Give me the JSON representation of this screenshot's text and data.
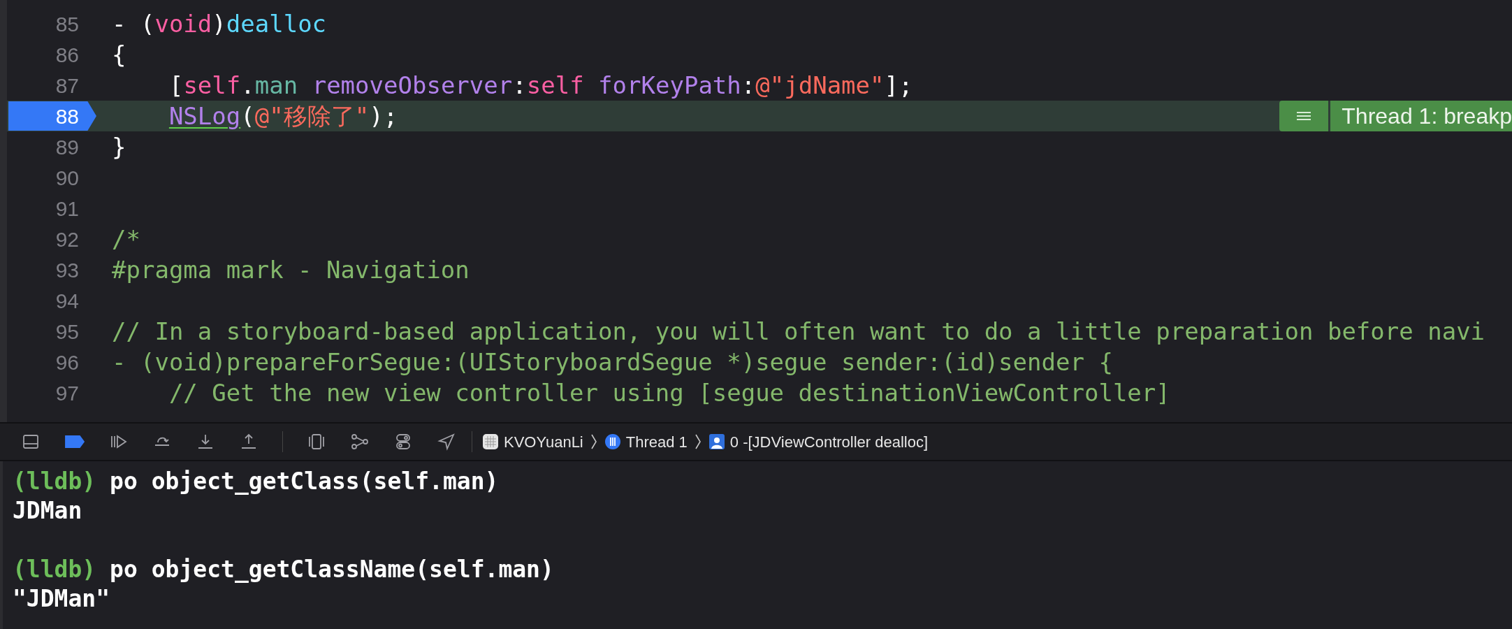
{
  "editor": {
    "lines": [
      {
        "number": "85",
        "current": false,
        "tokens": [
          {
            "text": "- (",
            "kind": "plain"
          },
          {
            "text": "void",
            "kind": "keyword"
          },
          {
            "text": ")",
            "kind": "plain"
          },
          {
            "text": "dealloc",
            "kind": "declaration"
          }
        ]
      },
      {
        "number": "86",
        "current": false,
        "tokens": [
          {
            "text": "{",
            "kind": "plain"
          }
        ]
      },
      {
        "number": "87",
        "current": false,
        "tokens": [
          {
            "text": "    [",
            "kind": "plain"
          },
          {
            "text": "self",
            "kind": "keyword"
          },
          {
            "text": ".",
            "kind": "plain"
          },
          {
            "text": "man",
            "kind": "property"
          },
          {
            "text": " removeObserver",
            "kind": "method"
          },
          {
            "text": ":",
            "kind": "plain"
          },
          {
            "text": "self",
            "kind": "keyword"
          },
          {
            "text": " forKeyPath",
            "kind": "method"
          },
          {
            "text": ":",
            "kind": "plain"
          },
          {
            "text": "@\"jdName\"",
            "kind": "string"
          },
          {
            "text": "];",
            "kind": "plain"
          }
        ]
      },
      {
        "number": "88",
        "current": true,
        "annotation": "Thread 1: breakp",
        "tokens": [
          {
            "text": "    NSLog",
            "kind": "issue"
          },
          {
            "text": "(",
            "kind": "plain"
          },
          {
            "text": "@\"移除了\"",
            "kind": "string"
          },
          {
            "text": ");",
            "kind": "plain"
          }
        ]
      },
      {
        "number": "89",
        "current": false,
        "tokens": [
          {
            "text": "}",
            "kind": "plain"
          }
        ]
      },
      {
        "number": "90",
        "current": false
      },
      {
        "number": "91",
        "current": false
      },
      {
        "number": "92",
        "current": false,
        "tokens": [
          {
            "text": "/*",
            "kind": "comment"
          }
        ]
      },
      {
        "number": "93",
        "current": false,
        "tokens": [
          {
            "text": "#pragma mark - Navigation",
            "kind": "comment"
          }
        ]
      },
      {
        "number": "94",
        "current": false
      },
      {
        "number": "95",
        "current": false,
        "tokens": [
          {
            "text": "// In a storyboard-based application, you will often want to do a little preparation before navi",
            "kind": "comment"
          }
        ]
      },
      {
        "number": "96",
        "current": false,
        "tokens": [
          {
            "text": "- (void)prepareForSegue:(UIStoryboardSegue *)segue sender:(id)sender {",
            "kind": "comment"
          }
        ]
      },
      {
        "number": "97",
        "current": false,
        "tokens": [
          {
            "text": "    // Get the new view controller using [segue destinationViewController]",
            "kind": "comment"
          }
        ]
      }
    ]
  },
  "debug_bar": {
    "breakpoints_active": true,
    "breadcrumbs": [
      {
        "kind": "app",
        "label": "KVOYuanLi"
      },
      {
        "kind": "thread",
        "label": "Thread 1"
      },
      {
        "kind": "frame",
        "label": "0 -[JDViewController dealloc]"
      }
    ]
  },
  "console": {
    "lines": [
      {
        "kind": "command",
        "prompt": "(lldb)",
        "text": "po object_getClass(self.man)"
      },
      {
        "kind": "output",
        "text": "JDMan"
      },
      {
        "kind": "command",
        "prompt": "(lldb)",
        "text": "po object_getClassName(self.man)"
      },
      {
        "kind": "output",
        "text": "\"JDMan\""
      }
    ]
  }
}
